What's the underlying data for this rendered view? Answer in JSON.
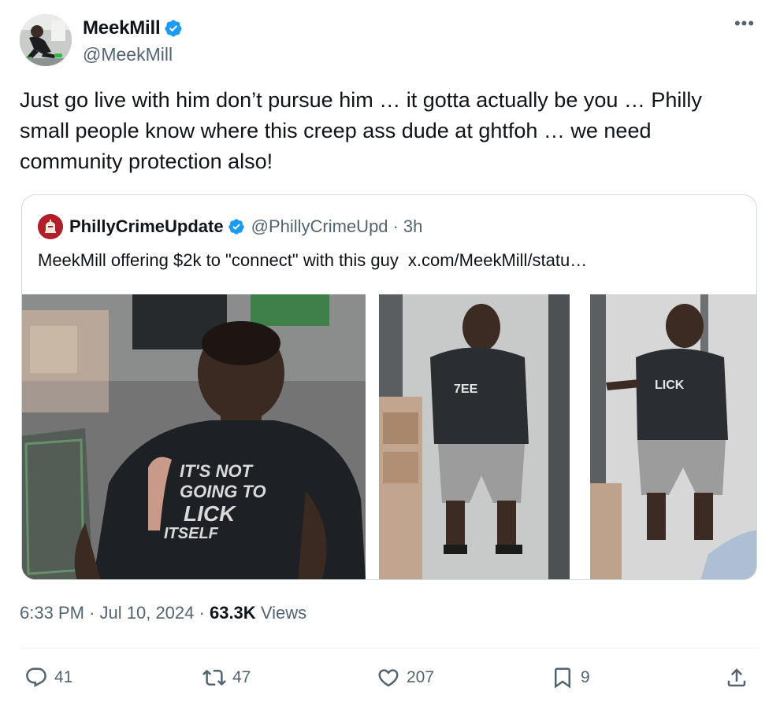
{
  "author": {
    "display_name": "MeekMill",
    "handle": "@MeekMill",
    "verified": true
  },
  "tweet": {
    "text": "Just go live with him don’t pursue him … it gotta actually be you … Philly small people know where this creep ass dude at ghtfoh … we need community protection also!"
  },
  "quoted": {
    "display_name": "PhillyCrimeUpdate",
    "handle": "@PhillyCrimeUpd",
    "separator": "·",
    "time": "3h",
    "text": "MeekMill offering $2k to \"connect\" with this guy",
    "link": "x.com/MeekMill/statu…",
    "image1_shirt_text": [
      "IT'S NOT",
      "GOING TO",
      "LICK",
      "ITSELF"
    ]
  },
  "meta": {
    "time": "6:33 PM",
    "sep": "·",
    "date": "Jul 10, 2024",
    "views_count": "63.3K",
    "views_label": "Views"
  },
  "actions": {
    "replies": "41",
    "reposts": "47",
    "likes": "207",
    "bookmarks": "9"
  },
  "colors": {
    "text": "#0f1419",
    "secondary": "#536471",
    "verified": "#1d9bf0",
    "border": "#cfd9de"
  },
  "icons": [
    "verified-badge-icon",
    "more-icon",
    "reply-icon",
    "repost-icon",
    "like-icon",
    "bookmark-icon",
    "share-icon"
  ]
}
